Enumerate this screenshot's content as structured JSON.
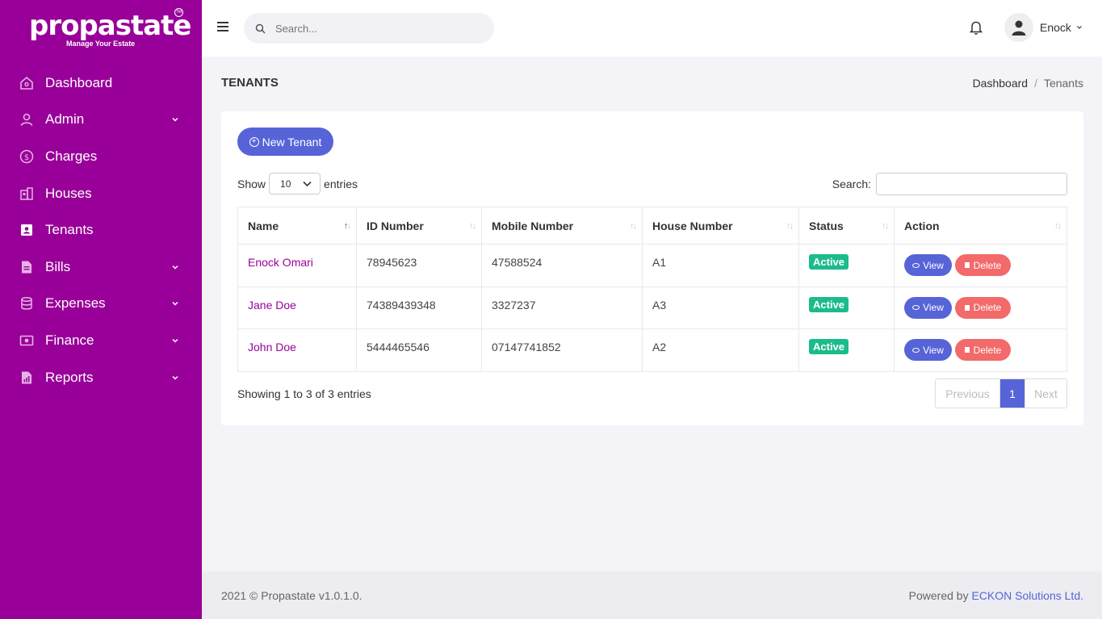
{
  "brand": {
    "name": "propastate",
    "tm": "TM",
    "tagline": "Manage Your Estate"
  },
  "sidebar": {
    "items": [
      {
        "label": "Dashboard",
        "icon": "home-icon",
        "has_submenu": false
      },
      {
        "label": "Admin",
        "icon": "user-icon",
        "has_submenu": true
      },
      {
        "label": "Charges",
        "icon": "dollar-icon",
        "has_submenu": false
      },
      {
        "label": "Houses",
        "icon": "building-icon",
        "has_submenu": false
      },
      {
        "label": "Tenants",
        "icon": "contacts-icon",
        "has_submenu": false
      },
      {
        "label": "Bills",
        "icon": "file-icon",
        "has_submenu": true
      },
      {
        "label": "Expenses",
        "icon": "database-icon",
        "has_submenu": true
      },
      {
        "label": "Finance",
        "icon": "money-icon",
        "has_submenu": true
      },
      {
        "label": "Reports",
        "icon": "report-icon",
        "has_submenu": true
      }
    ]
  },
  "topbar": {
    "search_placeholder": "Search...",
    "user_name": "Enock"
  },
  "page": {
    "title": "TENANTS",
    "breadcrumb": [
      "Dashboard",
      "Tenants"
    ],
    "separator": "/"
  },
  "toolbar": {
    "new_button": "New Tenant"
  },
  "length": {
    "show": "Show",
    "value": "10",
    "entries": "entries"
  },
  "filter": {
    "label": "Search:"
  },
  "table": {
    "columns": [
      "Name",
      "ID Number",
      "Mobile Number",
      "House Number",
      "Status",
      "Action"
    ],
    "rows": [
      {
        "name": "Enock Omari",
        "id": "78945623",
        "mobile": "47588524",
        "house": "A1",
        "status": "Active"
      },
      {
        "name": "Jane Doe",
        "id": "74389439348",
        "mobile": "3327237",
        "house": "A3",
        "status": "Active"
      },
      {
        "name": "John Doe",
        "id": "5444465546",
        "mobile": "07147741852",
        "house": "A2",
        "status": "Active"
      }
    ],
    "view_label": "View",
    "delete_label": "Delete"
  },
  "pagination": {
    "info": "Showing 1 to 3 of 3 entries",
    "previous": "Previous",
    "current": "1",
    "next": "Next"
  },
  "footer": {
    "copyright": "2021 © Propastate v1.0.1.0.",
    "powered_by": "Powered by",
    "company": "ECKON Solutions Ltd."
  },
  "colors": {
    "sidebar": "#990099",
    "accent": "#5664d8",
    "success": "#1cbb8c",
    "danger": "#f26a6a"
  }
}
